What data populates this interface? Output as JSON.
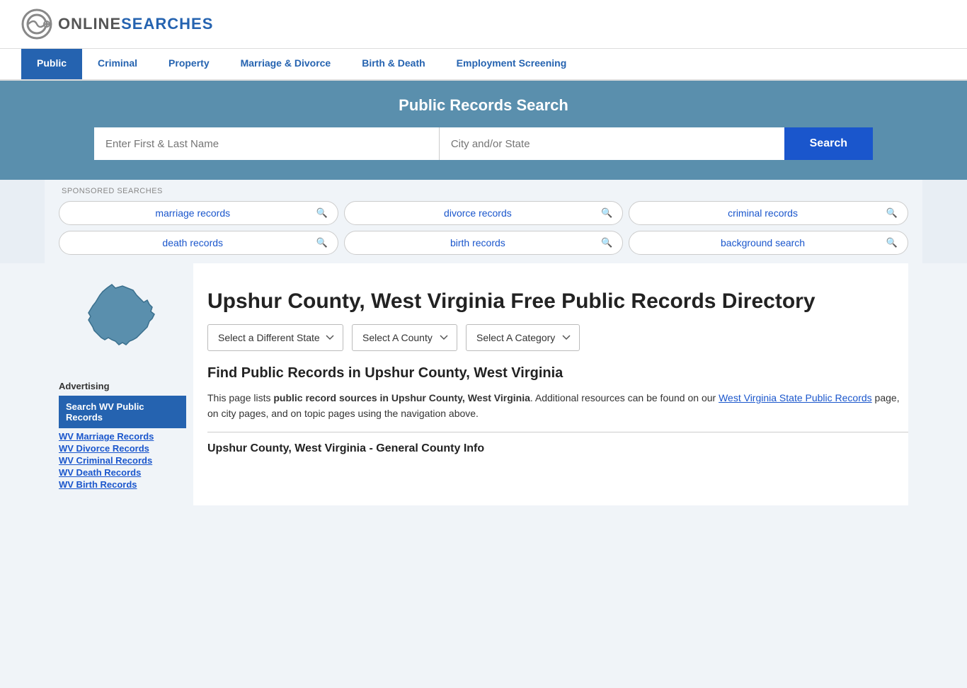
{
  "logo": {
    "online": "ONLINE",
    "searches": "SEARCHES"
  },
  "nav": {
    "items": [
      {
        "label": "Public",
        "active": true
      },
      {
        "label": "Criminal",
        "active": false
      },
      {
        "label": "Property",
        "active": false
      },
      {
        "label": "Marriage & Divorce",
        "active": false
      },
      {
        "label": "Birth & Death",
        "active": false
      },
      {
        "label": "Employment Screening",
        "active": false
      }
    ]
  },
  "search_banner": {
    "title": "Public Records Search",
    "name_placeholder": "Enter First & Last Name",
    "location_placeholder": "City and/or State",
    "button_label": "Search"
  },
  "sponsored": {
    "label": "SPONSORED SEARCHES",
    "pills": [
      {
        "text": "marriage records"
      },
      {
        "text": "divorce records"
      },
      {
        "text": "criminal records"
      },
      {
        "text": "death records"
      },
      {
        "text": "birth records"
      },
      {
        "text": "background search"
      }
    ]
  },
  "sidebar": {
    "ad_label": "Advertising",
    "ad_highlight": "Search WV Public Records",
    "links": [
      "WV Marriage Records",
      "WV Divorce Records",
      "WV Criminal Records",
      "WV Death Records",
      "WV Birth Records"
    ]
  },
  "content": {
    "page_title": "Upshur County, West Virginia Free Public Records Directory",
    "selectors": {
      "state": "Select a Different State",
      "county": "Select A County",
      "category": "Select A Category"
    },
    "find_title": "Find Public Records in Upshur County, West Virginia",
    "find_text_1": "This page lists ",
    "find_bold": "public record sources in Upshur County, West Virginia",
    "find_text_2": ". Additional resources can be found on our ",
    "find_link": "West Virginia State Public Records",
    "find_text_3": " page, on city pages, and on topic pages using the navigation above.",
    "county_info_title": "Upshur County, West Virginia - General County Info"
  }
}
